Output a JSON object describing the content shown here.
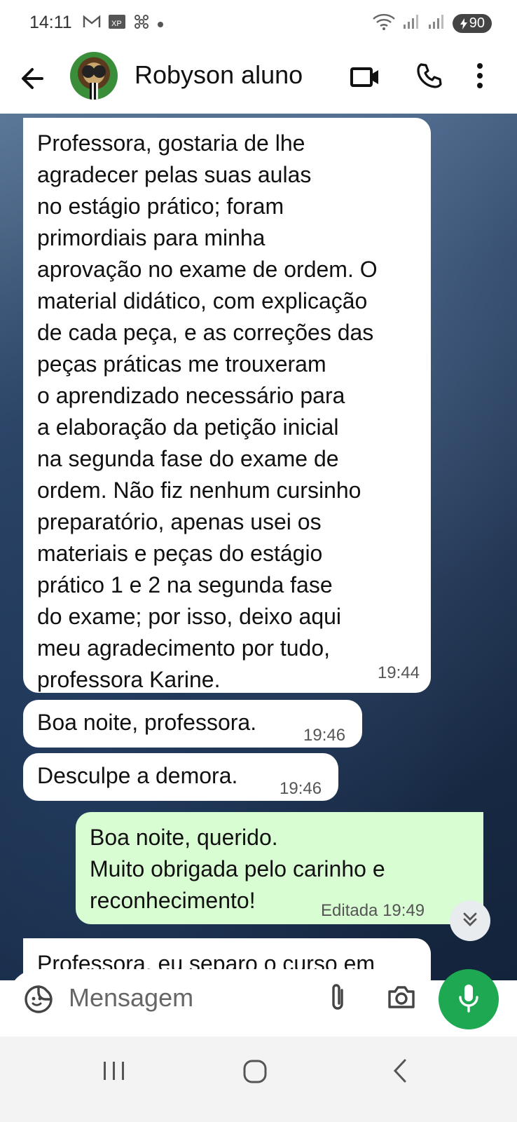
{
  "status_bar": {
    "time": "14:11",
    "battery": "90",
    "icons": [
      "gmail-icon",
      "xp-icon",
      "fan-icon",
      "dot-icon",
      "wifi-icon",
      "signal-icon",
      "signal-icon",
      "battery-icon"
    ]
  },
  "header": {
    "contact_name": "Robyson aluno"
  },
  "messages": [
    {
      "direction": "incoming",
      "text": "Professora, gostaria de lhe\nagradecer pelas suas aulas\nno estágio prático; foram\nprimordiais para minha\naprovação no exame de ordem. O\nmaterial didático, com explicação\nde cada peça, e as correções das\npeças práticas me trouxeram\no aprendizado necessário para\na elaboração da petição inicial\nna segunda fase do exame de\nordem. Não fiz nenhum cursinho\npreparatório, apenas usei os\nmateriais e peças do estágio\nprático 1 e 2 na segunda fase\ndo exame; por isso, deixo aqui\nmeu agradecimento por tudo,\nprofessora Karine.",
      "time": "19:44"
    },
    {
      "direction": "incoming",
      "text": "Boa noite, professora.",
      "time": "19:46"
    },
    {
      "direction": "incoming",
      "text": "Desculpe a demora.",
      "time": "19:46"
    },
    {
      "direction": "outgoing",
      "text": "Boa noite,  querido.\nMuito obrigada pelo carinho e\nreconhecimento!",
      "time": "Editada 19:49"
    },
    {
      "direction": "incoming",
      "text": "Professora, eu separo o curso em"
    }
  ],
  "input": {
    "placeholder": "Mensagem"
  },
  "colors": {
    "outgoing_bubble": "#d9fdd3",
    "incoming_bubble": "#ffffff",
    "mic_button": "#1da851"
  }
}
